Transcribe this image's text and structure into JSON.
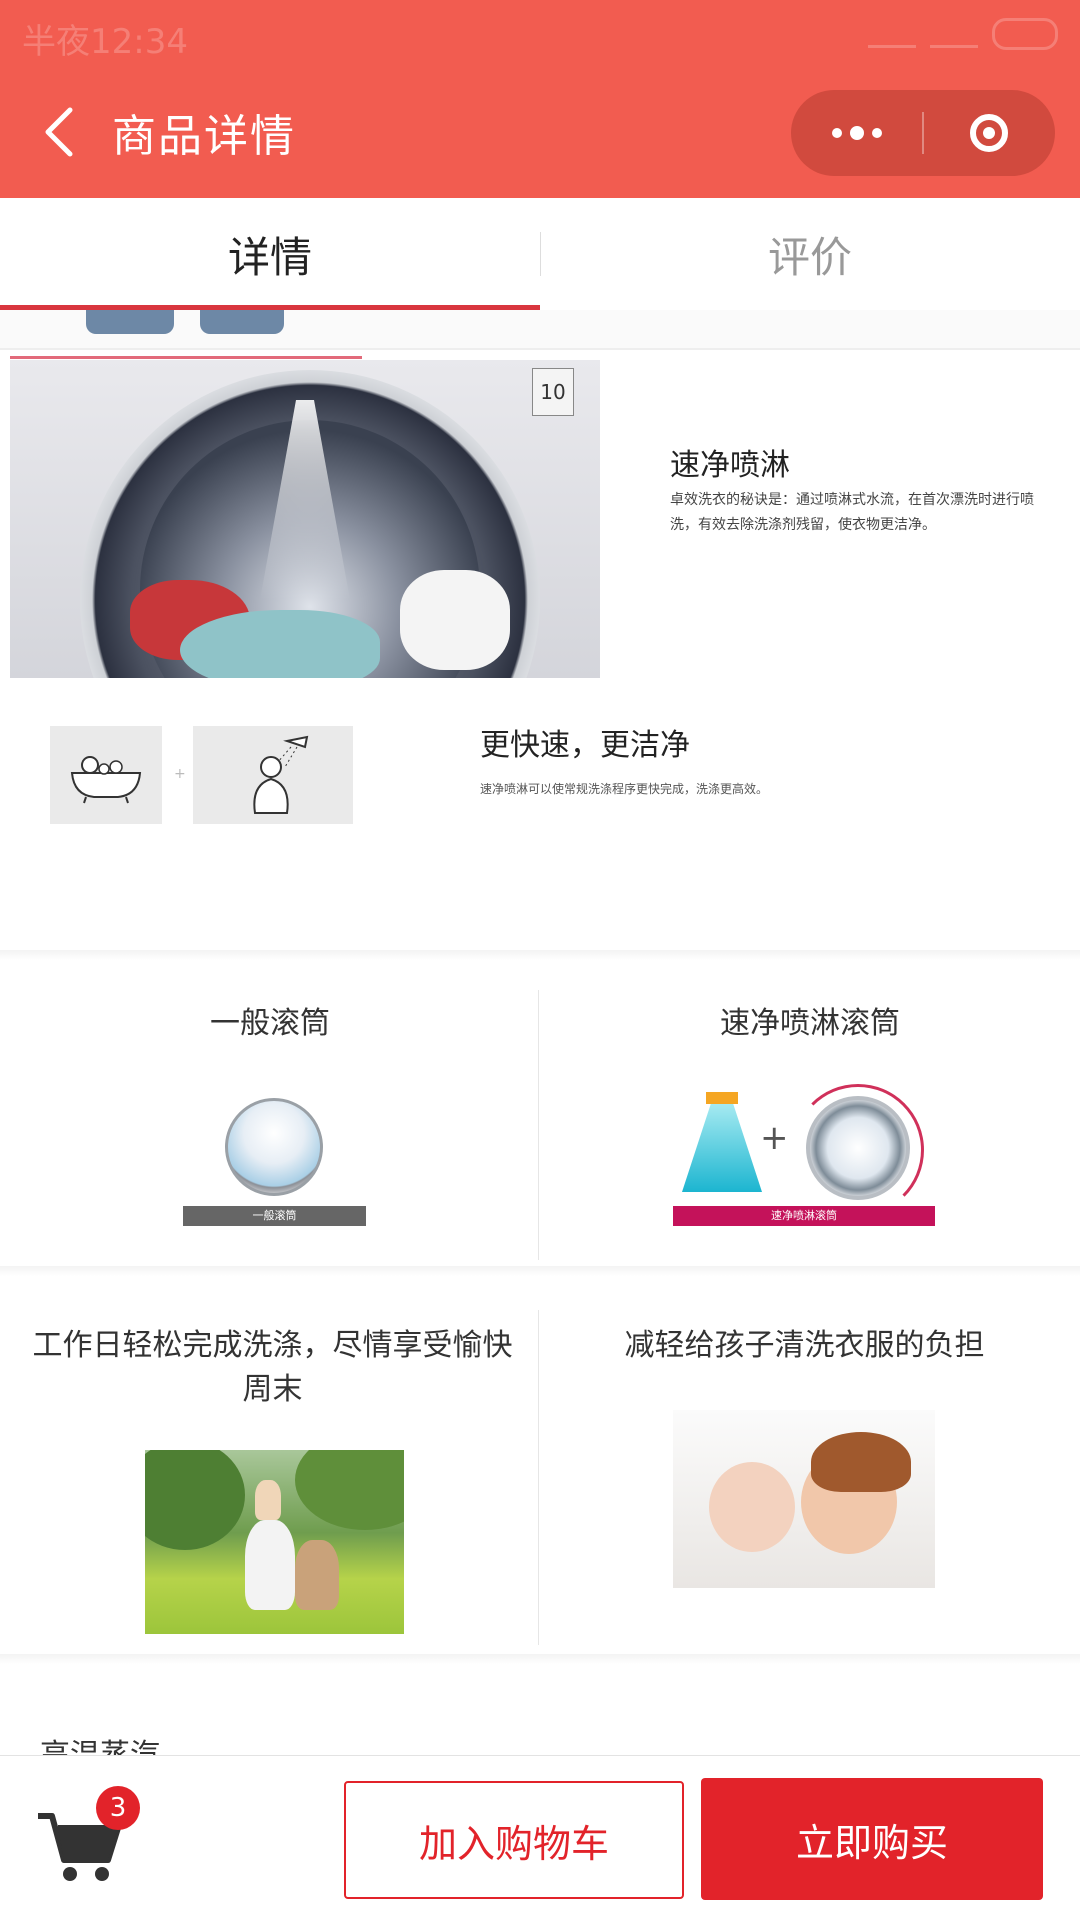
{
  "status_bar": {
    "time": "半夜12:34"
  },
  "nav": {
    "title": "商品详情"
  },
  "tabs": [
    {
      "label": "详情",
      "active": true
    },
    {
      "label": "评价",
      "active": false
    }
  ],
  "washer_badge": "10",
  "feature_spray": {
    "title": "速净喷淋",
    "desc": "卓效洗衣的秘诀是：通过喷淋式水流，在首次漂洗时进行喷洗，有效去除洗涤剂残留，使衣物更洁净。"
  },
  "feature_fast": {
    "title": "更快速，更洁净",
    "desc": "速净喷淋可以使常规洗涤程序更快完成，洗涤更高效。"
  },
  "compare": {
    "left_title": "一般滚筒",
    "left_bar": "一般滚筒",
    "right_title": "速净喷淋滚筒",
    "right_bar": "速净喷淋滚筒"
  },
  "benefits": {
    "left_title": "工作日轻松完成洗涤，尽情享受愉快周末",
    "right_title": "减轻给孩子清洗衣服的负担"
  },
  "next_section_title": "高温蒸汽",
  "bottom_bar": {
    "cart_count": "3",
    "add_to_cart": "加入购物车",
    "buy_now": "立即购买"
  },
  "colors": {
    "header": "#f25c50",
    "accent_red": "#e2232a",
    "tab_underline": "#d9363e"
  },
  "icons": [
    "back-arrow-icon",
    "more-dots-icon",
    "close-target-icon",
    "shopping-cart-icon"
  ]
}
